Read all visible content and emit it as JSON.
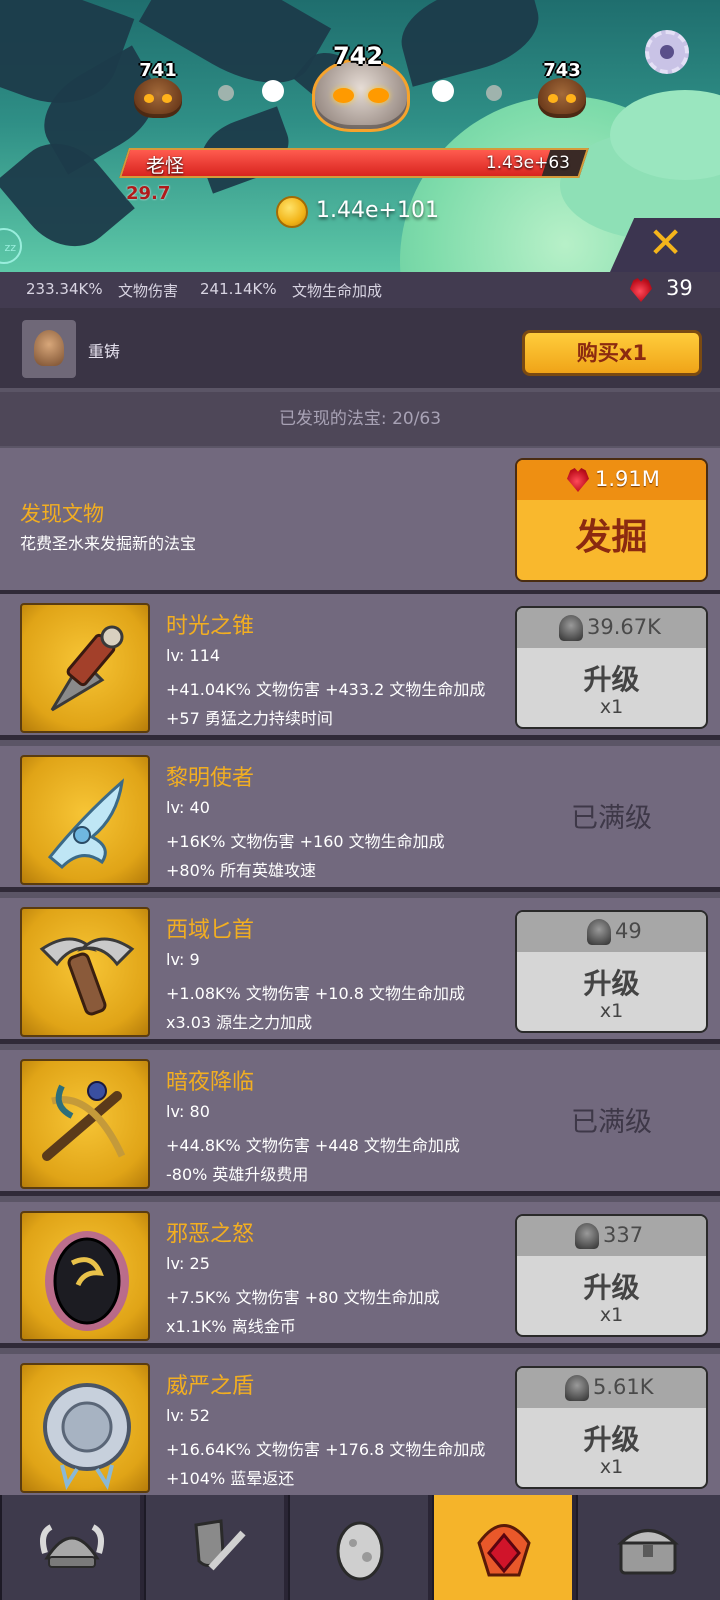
{
  "battle": {
    "stages": {
      "prev": "741",
      "current": "742",
      "next": "743"
    },
    "enemy_name": "老怪",
    "enemy_hp": "1.43e+63",
    "hp_fraction": 0.92,
    "timer": "29.7",
    "gold": "1.44e+101",
    "close_label": "✕",
    "sleep_label": "zz"
  },
  "stats": {
    "damage_value": "233.34K%",
    "damage_label": "文物伤害",
    "hp_value": "241.14K%",
    "hp_label": "文物生命加成",
    "gems": "39"
  },
  "reforge": {
    "label": "重铸",
    "buy_label": "购买x1"
  },
  "discovered": "已发现的法宝: 20/63",
  "discover": {
    "title": "发现文物",
    "desc": "花费圣水来发掘新的法宝",
    "cost": "1.91M",
    "button": "发掘"
  },
  "artifacts": [
    {
      "name": "时光之锥",
      "lv": "lv: 114",
      "line1": "+41.04K% 文物伤害 +433.2 文物生命加成",
      "line2": "+57 勇猛之力持续时间",
      "cost": "39.67K",
      "button": "升级",
      "mult": "x1",
      "maxed": "",
      "icon": "drill-icon"
    },
    {
      "name": "黎明使者",
      "lv": "lv: 40",
      "line1": "+16K% 文物伤害 +160 文物生命加成",
      "line2": "+80% 所有英雄攻速",
      "cost": "",
      "button": "",
      "mult": "",
      "maxed": "已满级",
      "icon": "blade-icon"
    },
    {
      "name": "西域匕首",
      "lv": "lv: 9",
      "line1": "+1.08K% 文物伤害 +10.8 文物生命加成",
      "line2": "x3.03 源生之力加成",
      "cost": "49",
      "button": "升级",
      "mult": "x1",
      "maxed": "",
      "icon": "dagger-icon"
    },
    {
      "name": "暗夜降临",
      "lv": "lv: 80",
      "line1": "+44.8K% 文物伤害 +448 文物生命加成",
      "line2": "-80% 英雄升级费用",
      "cost": "",
      "button": "",
      "mult": "",
      "maxed": "已满级",
      "icon": "crossbow-icon"
    },
    {
      "name": "邪恶之怒",
      "lv": "lv: 25",
      "line1": "+7.5K% 文物伤害 +80 文物生命加成",
      "line2": "x1.1K% 离线金币",
      "cost": "337",
      "button": "升级",
      "mult": "x1",
      "maxed": "",
      "icon": "dark-egg-icon"
    },
    {
      "name": "威严之盾",
      "lv": "lv: 52",
      "line1": "+16.64K% 文物伤害 +176.8 文物生命加成",
      "line2": "+104% 蓝晕返还",
      "cost": "5.61K",
      "button": "升级",
      "mult": "x1",
      "maxed": "",
      "icon": "round-shield-icon"
    }
  ],
  "nav": [
    {
      "icon": "viking-helmet-icon",
      "active": false
    },
    {
      "icon": "shield-sword-icon",
      "active": false
    },
    {
      "icon": "egg-icon",
      "active": false
    },
    {
      "icon": "ruby-crown-icon",
      "active": true
    },
    {
      "icon": "treasure-chest-icon",
      "active": false
    }
  ],
  "colors": {
    "accent": "#f5b42a",
    "title_orange": "#f2ae21",
    "hp_red": "#d8241f",
    "panel": "#72697e"
  }
}
